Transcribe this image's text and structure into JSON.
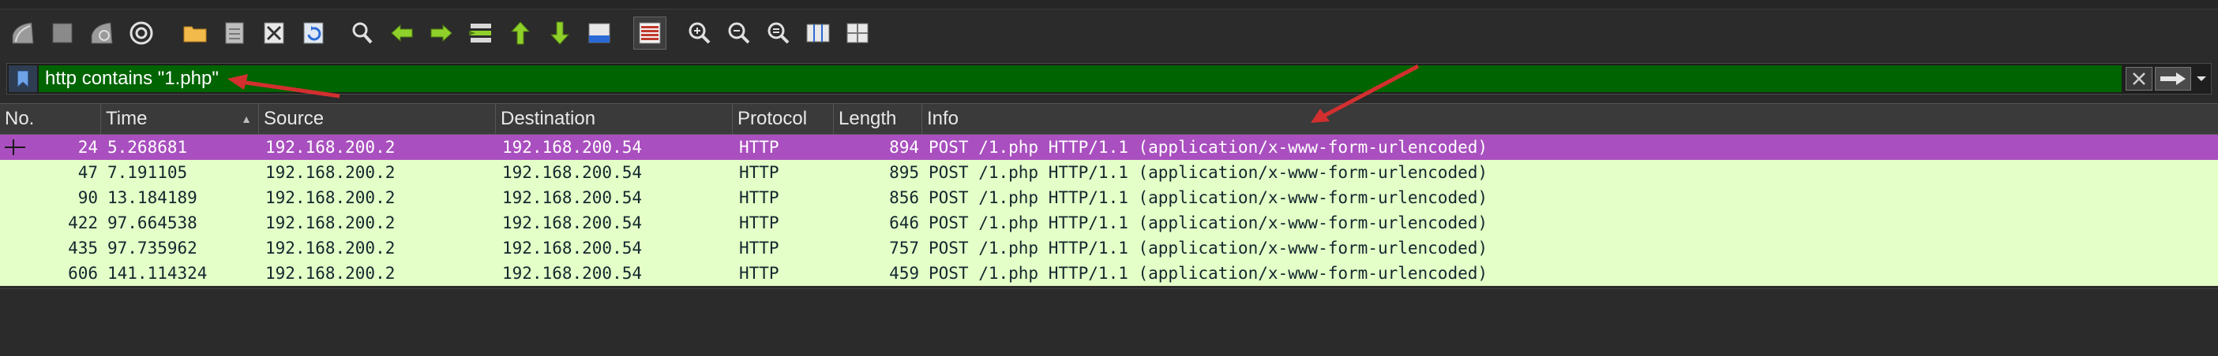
{
  "toolbar": {
    "buttons": [
      {
        "name": "start-capture-icon"
      },
      {
        "name": "stop-capture-icon"
      },
      {
        "name": "restart-capture-icon"
      },
      {
        "name": "capture-options-icon"
      },
      {
        "name": "open-file-icon"
      },
      {
        "name": "save-file-icon"
      },
      {
        "name": "close-file-icon"
      },
      {
        "name": "reload-file-icon"
      },
      {
        "name": "find-packet-icon"
      },
      {
        "name": "go-back-icon"
      },
      {
        "name": "go-forward-icon"
      },
      {
        "name": "go-to-packet-icon"
      },
      {
        "name": "go-first-packet-icon"
      },
      {
        "name": "go-last-packet-icon"
      },
      {
        "name": "auto-scroll-icon"
      },
      {
        "name": "colorize-icon"
      },
      {
        "name": "zoom-in-icon"
      },
      {
        "name": "zoom-out-icon"
      },
      {
        "name": "normal-size-icon"
      },
      {
        "name": "resize-columns-icon"
      },
      {
        "name": "layout-icon"
      }
    ]
  },
  "filter": {
    "value": "http contains \"1.php\"",
    "background": "#006400"
  },
  "packet_list": {
    "columns": [
      "No.",
      "Time",
      "Source",
      "Destination",
      "Protocol",
      "Length",
      "Info"
    ],
    "rows": [
      {
        "no": "24",
        "time": "5.268681",
        "source": "192.168.200.2",
        "destination": "192.168.200.54",
        "protocol": "HTTP",
        "length": "894",
        "info": "POST /1.php HTTP/1.1  (application/x-www-form-urlencoded)",
        "selected": true
      },
      {
        "no": "47",
        "time": "7.191105",
        "source": "192.168.200.2",
        "destination": "192.168.200.54",
        "protocol": "HTTP",
        "length": "895",
        "info": "POST /1.php HTTP/1.1  (application/x-www-form-urlencoded)",
        "selected": false
      },
      {
        "no": "90",
        "time": "13.184189",
        "source": "192.168.200.2",
        "destination": "192.168.200.54",
        "protocol": "HTTP",
        "length": "856",
        "info": "POST /1.php HTTP/1.1  (application/x-www-form-urlencoded)",
        "selected": false
      },
      {
        "no": "422",
        "time": "97.664538",
        "source": "192.168.200.2",
        "destination": "192.168.200.54",
        "protocol": "HTTP",
        "length": "646",
        "info": "POST /1.php HTTP/1.1  (application/x-www-form-urlencoded)",
        "selected": false
      },
      {
        "no": "435",
        "time": "97.735962",
        "source": "192.168.200.2",
        "destination": "192.168.200.54",
        "protocol": "HTTP",
        "length": "757",
        "info": "POST /1.php HTTP/1.1  (application/x-www-form-urlencoded)",
        "selected": false
      },
      {
        "no": "606",
        "time": "141.114324",
        "source": "192.168.200.2",
        "destination": "192.168.200.54",
        "protocol": "HTTP",
        "length": "459",
        "info": "POST /1.php HTTP/1.1  (application/x-www-form-urlencoded)",
        "selected": false
      }
    ]
  },
  "colors": {
    "row_bg": "#e4ffc7",
    "selected_bg": "#a94fbf",
    "annotation_arrow": "#d32f2f"
  }
}
